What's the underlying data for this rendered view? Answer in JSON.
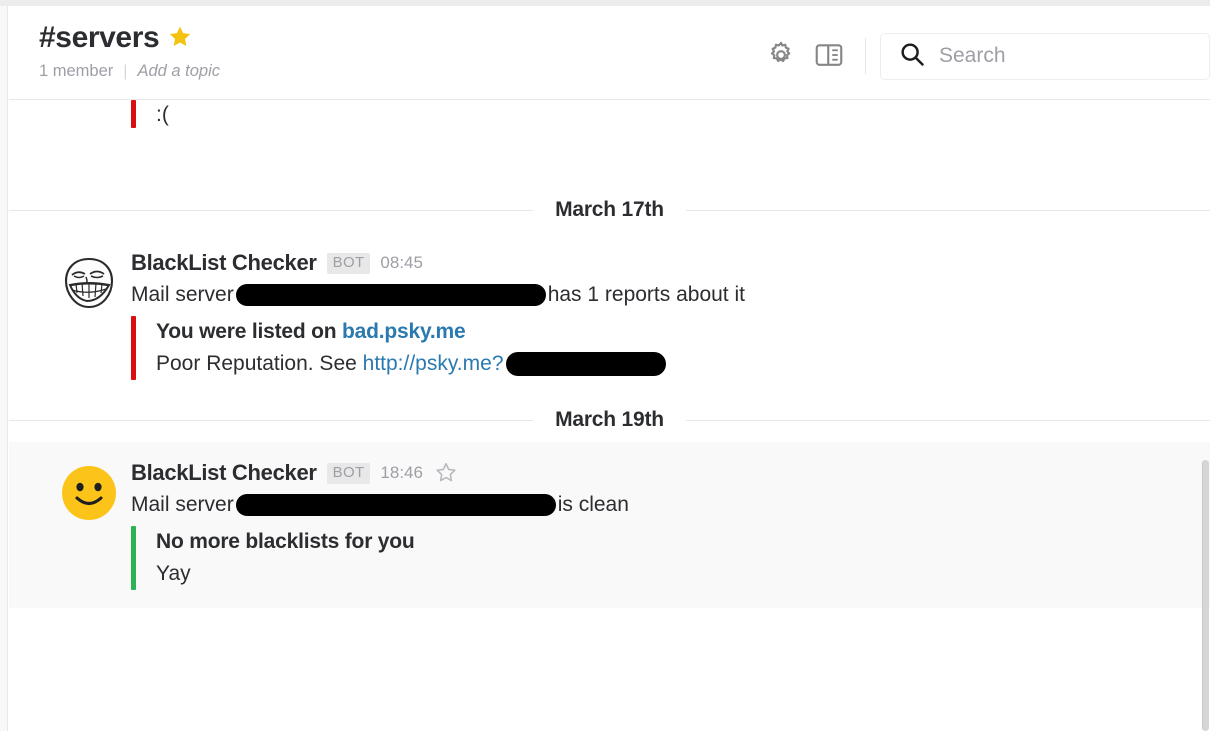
{
  "header": {
    "channel_name": "#servers",
    "starred": true,
    "star_color": "#f5c211",
    "members_label": "1 member",
    "separator": "|",
    "topic_placeholder": "Add a topic",
    "icons": {
      "settings": "gear-icon",
      "panel": "split-panel-icon",
      "search": "search-icon"
    },
    "search": {
      "placeholder": "Search",
      "value": ""
    }
  },
  "messages": {
    "partial_top": {
      "attachment_color": "#d91010",
      "text": ":("
    },
    "dividers": {
      "first": "March 17th",
      "second": "March 19th"
    },
    "items": [
      {
        "author": "BlackList Checker",
        "bot_badge": "BOT",
        "timestamp": "08:45",
        "avatar": "troll-face-avatar",
        "text_before": "Mail server",
        "redacted_1": "[redacted]",
        "text_after": "has 1 reports about it",
        "attachment": {
          "color": "#d91010",
          "title_prefix": "You were listed on",
          "title_link": "bad.psky.me",
          "body_prefix": "Poor Reputation. See",
          "body_link": "http://psky.me?",
          "body_redacted": "[redacted]"
        },
        "hovered": false,
        "saved": false
      },
      {
        "author": "BlackList Checker",
        "bot_badge": "BOT",
        "timestamp": "18:46",
        "avatar": "smiley-face-avatar",
        "text_before": "Mail server",
        "redacted_1": "[redacted]",
        "text_after": "is clean",
        "attachment": {
          "color": "#2eb153",
          "title_prefix": "No more blacklists for you",
          "title_link": "",
          "body_prefix": "Yay",
          "body_link": "",
          "body_redacted": ""
        },
        "hovered": true,
        "saved": false,
        "star_icon": "star-outline-icon"
      }
    ]
  },
  "colors": {
    "link": "#2a7ab0",
    "text": "#2c2d30",
    "muted": "#9e9ea6",
    "hover_row": "#f9f9f9",
    "border": "#e8e8e8"
  }
}
